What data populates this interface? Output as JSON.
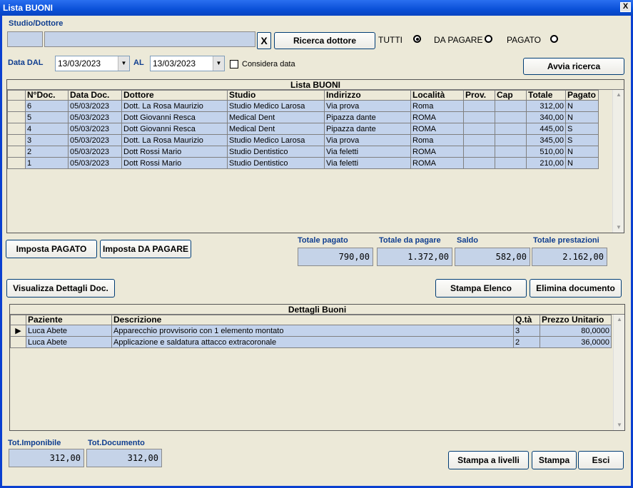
{
  "window": {
    "title": "Lista BUONI",
    "close_label": "X"
  },
  "search": {
    "studio_label": "Studio/Dottore",
    "clear_label": "X",
    "ricerca_button": "Ricerca dottore",
    "filters": [
      {
        "label": "TUTTI",
        "selected": true
      },
      {
        "label": "DA PAGARE",
        "selected": false
      },
      {
        "label": "PAGATO",
        "selected": false
      }
    ],
    "data_dal_label": "Data DAL",
    "data_dal_value": "13/03/2023",
    "al_label": "AL",
    "al_value": "13/03/2023",
    "considera_label": "Considera data",
    "avvia_button": "Avvia ricerca"
  },
  "lista": {
    "title": "Lista BUONI",
    "columns": [
      "N°Doc.",
      "Data Doc.",
      "Dottore",
      "Studio",
      "Indirizzo",
      "Località",
      "Prov.",
      "Cap",
      "Totale",
      "Pagato"
    ],
    "rows": [
      [
        "6",
        "05/03/2023",
        "Dott. La Rosa Maurizio",
        "Studio Medico Larosa",
        "Via prova",
        "Roma",
        "",
        "",
        "312,00",
        "N"
      ],
      [
        "5",
        "05/03/2023",
        "Dott Giovanni Resca",
        "Medical Dent",
        "Pipazza dante",
        "ROMA",
        "",
        "",
        "340,00",
        "N"
      ],
      [
        "4",
        "05/03/2023",
        "Dott Giovanni Resca",
        "Medical Dent",
        "Pipazza dante",
        "ROMA",
        "",
        "",
        "445,00",
        "S"
      ],
      [
        "3",
        "05/03/2023",
        "Dott. La Rosa Maurizio",
        "Studio Medico Larosa",
        "Via prova",
        "Roma",
        "",
        "",
        "345,00",
        "S"
      ],
      [
        "2",
        "05/03/2023",
        "Dott Rossi Mario",
        "Studio Dentistico",
        "Via feletti",
        "ROMA",
        "",
        "",
        "510,00",
        "N"
      ],
      [
        "1",
        "05/03/2023",
        "Dott Rossi Mario",
        "Studio Dentistico",
        "Via feletti",
        "ROMA",
        "",
        "",
        "210,00",
        "N"
      ]
    ]
  },
  "actions": {
    "imposta_pagato": "Imposta PAGATO",
    "imposta_da_pagare": "Imposta DA PAGARE",
    "visualizza": "Visualizza Dettagli Doc.",
    "stampa_elenco": "Stampa Elenco",
    "elimina": "Elimina documento"
  },
  "totals": {
    "pagato_label": "Totale pagato",
    "pagato_value": "790,00",
    "da_pagare_label": "Totale da pagare",
    "da_pagare_value": "1.372,00",
    "saldo_label": "Saldo",
    "saldo_value": "582,00",
    "prestazioni_label": "Totale prestazioni",
    "prestazioni_value": "2.162,00"
  },
  "dettagli": {
    "title": "Dettagli Buoni",
    "columns": [
      "Paziente",
      "Descrizione",
      "Q.tà",
      "Prezzo Unitario"
    ],
    "rows": [
      [
        "Luca Abete",
        "Apparecchio provvisorio con 1 elemento montato",
        "3",
        "80,0000"
      ],
      [
        "Luca Abete",
        "Applicazione e saldatura attacco extracoronale",
        "2",
        "36,0000"
      ]
    ]
  },
  "footer": {
    "imponibile_label": "Tot.Imponibile",
    "imponibile_value": "312,00",
    "documento_label": "Tot.Documento",
    "documento_value": "312,00",
    "stampa_livelli": "Stampa a livelli",
    "stampa": "Stampa",
    "esci": "Esci"
  }
}
